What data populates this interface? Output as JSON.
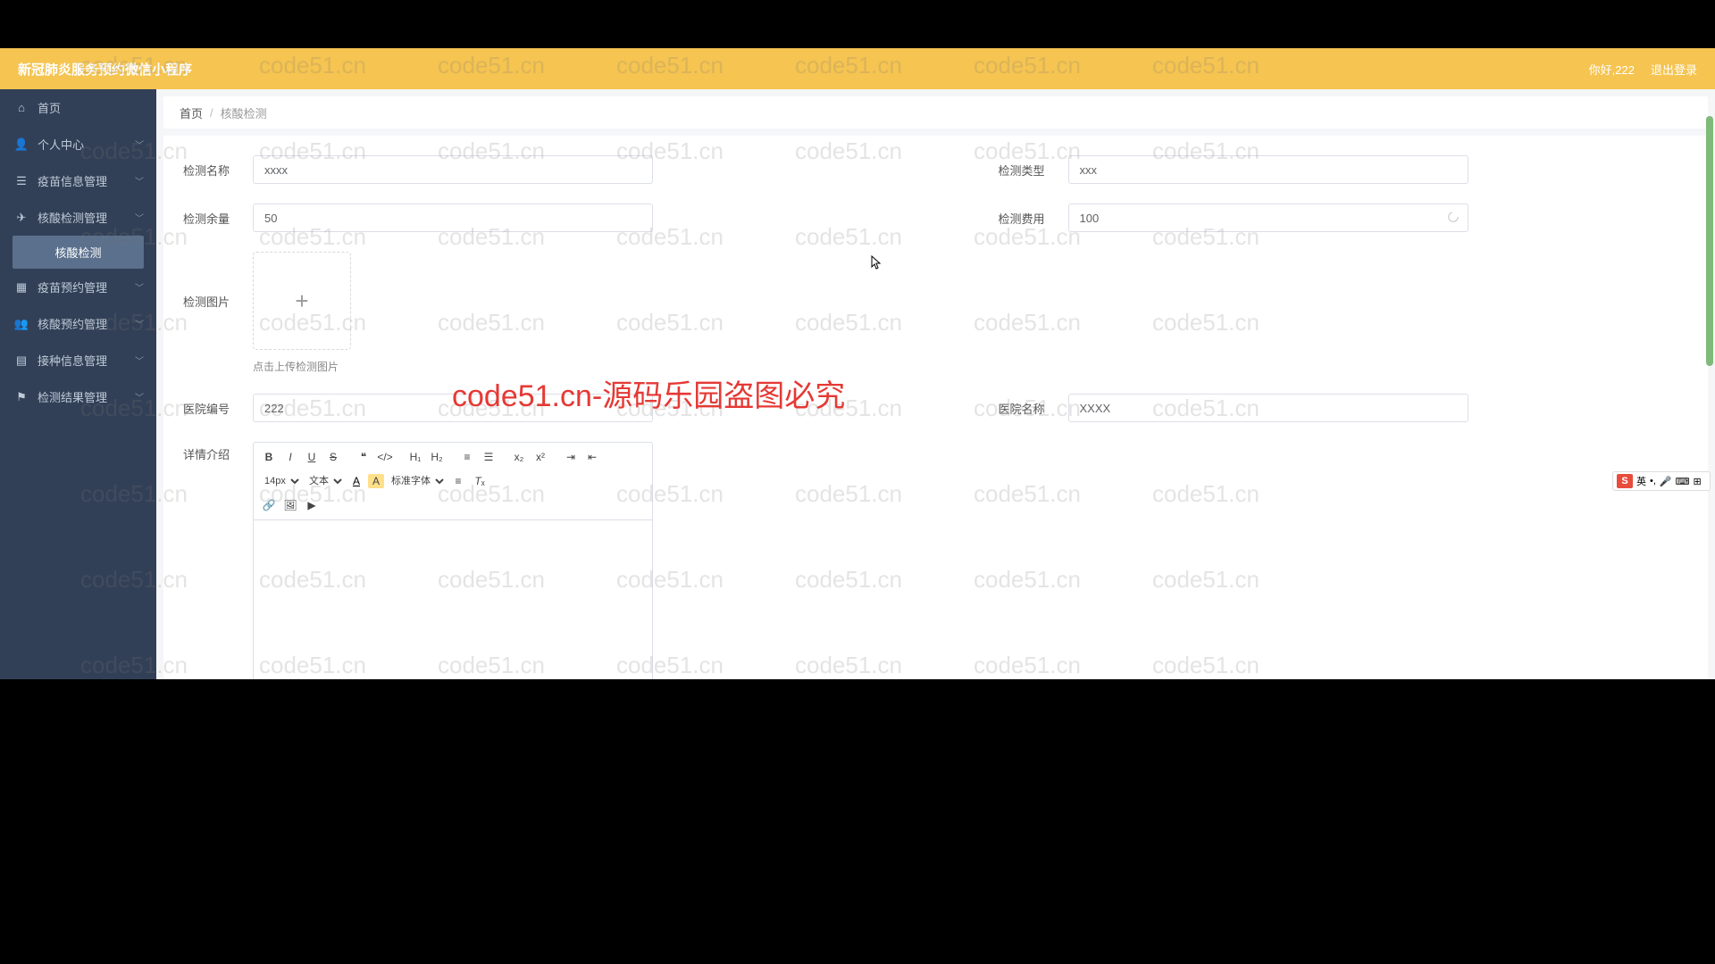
{
  "header": {
    "title": "新冠肺炎服务预约微信小程序",
    "greeting": "你好,222",
    "logout": "退出登录"
  },
  "sidebar": {
    "items": [
      {
        "icon": "home",
        "label": "首页",
        "expandable": false
      },
      {
        "icon": "user",
        "label": "个人中心",
        "expandable": true
      },
      {
        "icon": "bars",
        "label": "疫苗信息管理",
        "expandable": true
      },
      {
        "icon": "plane",
        "label": "核酸检测管理",
        "expandable": true,
        "expanded": true,
        "children": [
          {
            "label": "核酸检测",
            "active": true
          }
        ]
      },
      {
        "icon": "grid",
        "label": "疫苗预约管理",
        "expandable": true
      },
      {
        "icon": "user2",
        "label": "核酸预约管理",
        "expandable": true
      },
      {
        "icon": "doc",
        "label": "接种信息管理",
        "expandable": true
      },
      {
        "icon": "flag",
        "label": "检测结果管理",
        "expandable": true
      }
    ]
  },
  "breadcrumb": {
    "root": "首页",
    "sep": "/",
    "current": "核酸检测"
  },
  "form": {
    "test_name": {
      "label": "检测名称",
      "value": "xxxx"
    },
    "test_type": {
      "label": "检测类型",
      "value": "xxx"
    },
    "test_qty": {
      "label": "检测余量",
      "value": "50"
    },
    "test_fee": {
      "label": "检测费用",
      "value": "100"
    },
    "test_img": {
      "label": "检测图片",
      "hint": "点击上传检测图片"
    },
    "hosp_id": {
      "label": "医院编号",
      "value": "222"
    },
    "hosp_name": {
      "label": "医院名称",
      "value": "XXXX"
    },
    "detail": {
      "label": "详情介绍"
    }
  },
  "editor": {
    "fontsize": "14px",
    "format": "文本",
    "fontfamily": "标准字体"
  },
  "watermark": {
    "text": "code51.cn",
    "red": "code51.cn-源码乐园盗图必究"
  },
  "ime": {
    "lang": "英"
  }
}
